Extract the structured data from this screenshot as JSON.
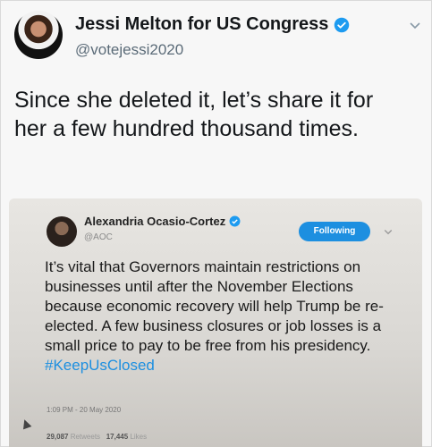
{
  "tweet": {
    "author_name": "Jessi Melton for US Congress",
    "author_handle": "@votejessi2020",
    "text": "Since she deleted it, let’s share it for her a few hundred thousand times."
  },
  "embedded_tweet": {
    "author_name": "Alexandria Ocasio-Cortez",
    "author_handle": "@AOC",
    "follow_label": "Following",
    "text": "It’s vital that Governors maintain restrictions on businesses until after the November Elections because economic recovery will help Trump be re-elected. A few business closures or job losses is a small price to pay to be free from his presidency.",
    "hashtag": "#KeepUsClosed",
    "timestamp": "1:09 PM - 20 May 2020",
    "retweets_count": "29,087",
    "retweets_label": "Retweets",
    "likes_count": "17,445",
    "likes_label": "Likes"
  },
  "icons": {
    "verified": "verified-badge-icon",
    "chevron": "chevron-down-icon"
  },
  "colors": {
    "verified_blue": "#1d9bf0",
    "follow_button": "#1d8fe0",
    "hashtag": "#1d8fe0"
  }
}
